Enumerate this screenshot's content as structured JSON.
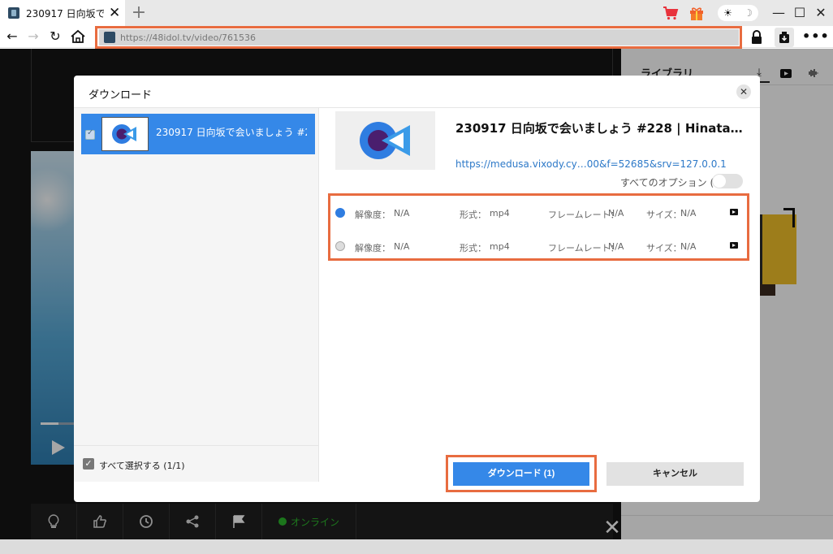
{
  "tab": {
    "title": "230917 日向坂で",
    "favicon": "site-favicon-icon",
    "close": "close-tab-icon"
  },
  "titlebar": {
    "new_tab": "+",
    "cart": "cart-icon",
    "gift": "gift-icon",
    "theme_toggle": [
      "sun-icon",
      "moon-icon"
    ],
    "window_controls": [
      "minimize-icon",
      "maximize-icon",
      "close-window-icon"
    ]
  },
  "navbar": {
    "url": "https://48idol.tv/video/761536",
    "buttons": [
      "back-icon",
      "forward-icon",
      "reload-icon",
      "home-icon",
      "lock-icon",
      "download-extension-icon",
      "more-icon"
    ]
  },
  "library": {
    "title": "ライブラリ",
    "tabs": [
      "download-icon",
      "video-icon",
      "audio-icon"
    ]
  },
  "video_bar": {
    "online_label": "オンライン",
    "icons": [
      "bulb-icon",
      "thumbs-up-icon",
      "clock-icon",
      "share-icon",
      "flag-icon"
    ]
  },
  "modal": {
    "title": "ダウンロード",
    "close": "close-icon",
    "items": [
      {
        "title": "230917 日向坂で会いましょう #2…",
        "checked": true
      }
    ],
    "select_all_label": "すべて選択する (1/1)",
    "detail": {
      "title": "230917 日向坂で会いましょう #228 | Hinata…",
      "url": "https://medusa.vixody.cy…00&f=52685&srv=127.0.0.1",
      "all_options_label": "すべてのオプション (2)"
    },
    "format_labels": {
      "resolution": "解像度：",
      "format": "形式：",
      "framerate": "フレームレート：",
      "size": "サイズ："
    },
    "formats": [
      {
        "resolution": "N/A",
        "format": "mp4",
        "framerate": "N/A",
        "size": "N/A",
        "selected": true
      },
      {
        "resolution": "N/A",
        "format": "mp4",
        "framerate": "N/A",
        "size": "N/A",
        "selected": false
      }
    ],
    "download_button": "ダウンロード (1)",
    "cancel_button": "キャンセル"
  },
  "colors": {
    "accent": "#3588e8",
    "highlight_outline": "#e86c40",
    "online": "#2cb52c",
    "link": "#2d79c8"
  }
}
